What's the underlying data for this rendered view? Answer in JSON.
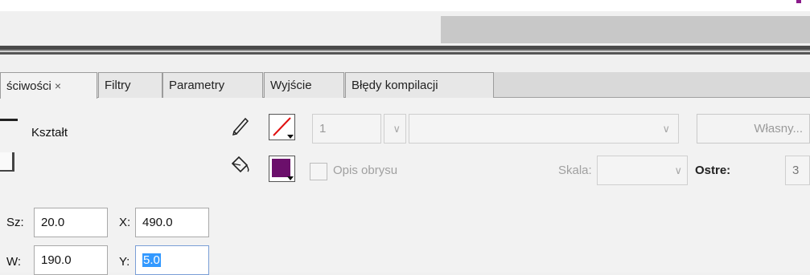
{
  "tabs": [
    {
      "label": "ściwości",
      "close": "×"
    },
    {
      "label": "Filtry"
    },
    {
      "label": "Parametry"
    },
    {
      "label": "Wyjście"
    },
    {
      "label": "Błędy kompilacji"
    }
  ],
  "object": {
    "type_label": "Kształt"
  },
  "stroke": {
    "width_value": "1",
    "style_value": "",
    "custom_button": "Własny..."
  },
  "fill": {
    "color": "#6b0f6b",
    "hinting_label": "Opis obrysu"
  },
  "scale": {
    "label": "Skala:",
    "value": ""
  },
  "joints": {
    "label": "Ostre:",
    "value": "3"
  },
  "position": {
    "w_label": "Sz:",
    "w_value": "20.0",
    "x_label": "X:",
    "x_value": "490.0",
    "h_label": "W:",
    "h_value": "190.0",
    "y_label": "Y:",
    "y_value": "5.0"
  },
  "colors": {
    "stroke_none_slash": "#e01010",
    "fill_swatch": "#6b0f6b",
    "top_mark": "#8b1a8b"
  }
}
